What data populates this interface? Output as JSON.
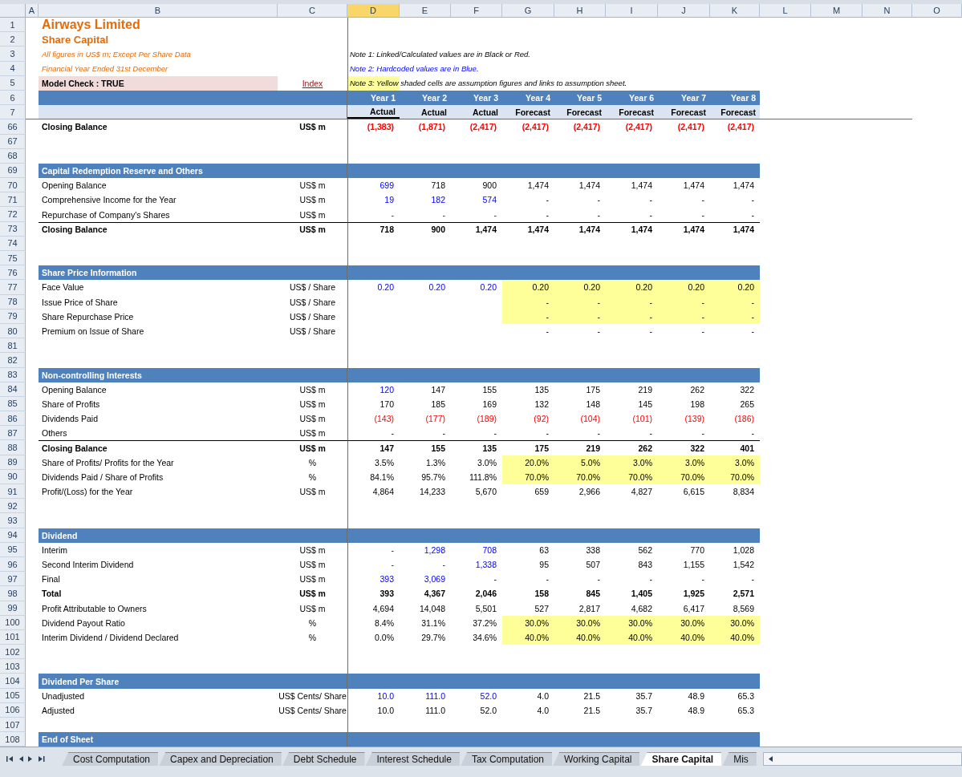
{
  "column_headers": [
    {
      "label": "A",
      "selected": false
    },
    {
      "label": "B",
      "selected": false
    },
    {
      "label": "C",
      "selected": false
    },
    {
      "label": "D",
      "selected": true
    },
    {
      "label": "E",
      "selected": false
    },
    {
      "label": "F",
      "selected": false
    },
    {
      "label": "G",
      "selected": false
    },
    {
      "label": "H",
      "selected": false
    },
    {
      "label": "I",
      "selected": false
    },
    {
      "label": "J",
      "selected": false
    },
    {
      "label": "K",
      "selected": false
    },
    {
      "label": "L",
      "selected": false
    },
    {
      "label": "M",
      "selected": false
    },
    {
      "label": "N",
      "selected": false
    },
    {
      "label": "O",
      "selected": false
    }
  ],
  "rows": [
    {
      "number": "1",
      "kind": "title",
      "text": "Airways Limited"
    },
    {
      "number": "2",
      "kind": "subtitle",
      "text": "Share Capital"
    },
    {
      "number": "3",
      "kind": "info",
      "text": "All figures in US$ m; Except Per Share Data",
      "note": {
        "text": "Note 1: Linked/Calculated values are in Black or Red.",
        "input": false,
        "highlighted": false
      }
    },
    {
      "number": "4",
      "kind": "info",
      "text": "Financial Year Ended 31st December",
      "note": {
        "text": "Note 2: Hardcoded values are in Blue.",
        "input": true,
        "highlighted": false
      }
    },
    {
      "number": "5",
      "kind": "check",
      "text": "Model Check : TRUE",
      "link": "Index",
      "note": {
        "text": "Note 3: Yellow shaded cells are assumption figures and links to assumption sheet.",
        "input": false,
        "highlighted": true
      }
    },
    {
      "number": "6",
      "kind": "years",
      "values": [
        "Year 1",
        "Year 2",
        "Year 3",
        "Year 4",
        "Year 5",
        "Year 6",
        "Year 7",
        "Year 8"
      ]
    },
    {
      "number": "7",
      "kind": "periods",
      "values": [
        {
          "text": "Actual",
          "selected": true
        },
        {
          "text": "Actual",
          "selected": false
        },
        {
          "text": "Actual",
          "selected": false
        },
        {
          "text": "Forecast",
          "selected": false
        },
        {
          "text": "Forecast",
          "selected": false
        },
        {
          "text": "Forecast",
          "selected": false
        },
        {
          "text": "Forecast",
          "selected": false
        },
        {
          "text": "Forecast",
          "selected": false
        }
      ]
    },
    {
      "number": "66",
      "kind": "data",
      "label": "Closing Balance",
      "unit": "US$ m",
      "bold": true,
      "rule": false,
      "shaded": false,
      "negative": true,
      "actuals": [
        {
          "text": "(1,383)",
          "input": false
        },
        {
          "text": "(1,871)",
          "input": false
        },
        {
          "text": "(2,417)",
          "input": false
        }
      ],
      "forecasts": [
        "(2,417)",
        "(2,417)",
        "(2,417)",
        "(2,417)",
        "(2,417)"
      ]
    },
    {
      "number": "67",
      "kind": "blank"
    },
    {
      "number": "68",
      "kind": "blank"
    },
    {
      "number": "69",
      "kind": "section",
      "text": "Capital Redemption Reserve and Others"
    },
    {
      "number": "70",
      "kind": "data",
      "label": "Opening Balance",
      "unit": "US$ m",
      "bold": false,
      "rule": false,
      "shaded": false,
      "negative": false,
      "actuals": [
        {
          "text": "699",
          "input": true
        },
        {
          "text": "718",
          "input": false
        },
        {
          "text": "900",
          "input": false
        }
      ],
      "forecasts": [
        "1,474",
        "1,474",
        "1,474",
        "1,474",
        "1,474"
      ]
    },
    {
      "number": "71",
      "kind": "data",
      "label": "Comprehensive Income for the Year",
      "unit": "US$ m",
      "bold": false,
      "rule": false,
      "shaded": false,
      "negative": false,
      "actuals": [
        {
          "text": "19",
          "input": true
        },
        {
          "text": "182",
          "input": true
        },
        {
          "text": "574",
          "input": true
        }
      ],
      "forecasts": [
        "-",
        "-",
        "-",
        "-",
        "-"
      ]
    },
    {
      "number": "72",
      "kind": "data",
      "label": "Repurchase of Company's Shares",
      "unit": "US$ m",
      "bold": false,
      "rule": false,
      "shaded": false,
      "negative": false,
      "actuals": [
        {
          "text": "-",
          "input": true
        },
        {
          "text": "-",
          "input": true
        },
        {
          "text": "-",
          "input": true
        }
      ],
      "forecasts": [
        "-",
        "-",
        "-",
        "-",
        "-"
      ]
    },
    {
      "number": "73",
      "kind": "data",
      "label": "Closing Balance",
      "unit": "US$ m",
      "bold": true,
      "rule": true,
      "shaded": false,
      "negative": false,
      "actuals": [
        {
          "text": "718",
          "input": false
        },
        {
          "text": "900",
          "input": false
        },
        {
          "text": "1,474",
          "input": false
        }
      ],
      "forecasts": [
        "1,474",
        "1,474",
        "1,474",
        "1,474",
        "1,474"
      ]
    },
    {
      "number": "74",
      "kind": "blank"
    },
    {
      "number": "75",
      "kind": "blank"
    },
    {
      "number": "76",
      "kind": "section",
      "text": "Share Price Information"
    },
    {
      "number": "77",
      "kind": "data",
      "label": "Face Value",
      "unit": "US$ / Share",
      "bold": false,
      "rule": false,
      "shaded": true,
      "negative": false,
      "actuals": [
        {
          "text": "0.20",
          "input": true
        },
        {
          "text": "0.20",
          "input": true
        },
        {
          "text": "0.20",
          "input": true
        }
      ],
      "forecasts": [
        "0.20",
        "0.20",
        "0.20",
        "0.20",
        "0.20"
      ]
    },
    {
      "number": "78",
      "kind": "data",
      "label": "Issue Price of Share",
      "unit": "US$ / Share",
      "bold": false,
      "rule": false,
      "shaded": true,
      "negative": false,
      "forecasts": [
        "-",
        "-",
        "-",
        "-",
        "-"
      ]
    },
    {
      "number": "79",
      "kind": "data",
      "label": "Share Repurchase Price",
      "unit": "US$ / Share",
      "bold": false,
      "rule": false,
      "shaded": true,
      "negative": false,
      "forecasts": [
        "-",
        "-",
        "-",
        "-",
        "-"
      ]
    },
    {
      "number": "80",
      "kind": "data",
      "label": "Premium on Issue of Share",
      "unit": "US$ / Share",
      "bold": false,
      "rule": false,
      "shaded": false,
      "negative": false,
      "forecasts": [
        "-",
        "-",
        "-",
        "-",
        "-"
      ]
    },
    {
      "number": "81",
      "kind": "blank"
    },
    {
      "number": "82",
      "kind": "blank"
    },
    {
      "number": "83",
      "kind": "section",
      "text": "Non-controlling Interests"
    },
    {
      "number": "84",
      "kind": "data",
      "label": "Opening Balance",
      "unit": "US$ m",
      "bold": false,
      "rule": false,
      "shaded": false,
      "negative": false,
      "actuals": [
        {
          "text": "120",
          "input": true
        },
        {
          "text": "147",
          "input": false
        },
        {
          "text": "155",
          "input": false
        }
      ],
      "forecasts": [
        "135",
        "175",
        "219",
        "262",
        "322"
      ]
    },
    {
      "number": "85",
      "kind": "data",
      "label": "Share of Profits",
      "unit": "US$ m",
      "bold": false,
      "rule": false,
      "shaded": false,
      "negative": false,
      "actuals": [
        {
          "text": "170",
          "input": false
        },
        {
          "text": "185",
          "input": false
        },
        {
          "text": "169",
          "input": false
        }
      ],
      "forecasts": [
        "132",
        "148",
        "145",
        "198",
        "265"
      ]
    },
    {
      "number": "86",
      "kind": "data",
      "label": "Dividends Paid",
      "unit": "US$ m",
      "bold": false,
      "rule": false,
      "shaded": false,
      "negative": true,
      "actuals": [
        {
          "text": "(143)",
          "input": false
        },
        {
          "text": "(177)",
          "input": false
        },
        {
          "text": "(189)",
          "input": false
        }
      ],
      "forecasts": [
        "(92)",
        "(104)",
        "(101)",
        "(139)",
        "(186)"
      ]
    },
    {
      "number": "87",
      "kind": "data",
      "label": "Others",
      "unit": "US$ m",
      "bold": false,
      "rule": false,
      "shaded": false,
      "negative": false,
      "actuals": [
        {
          "text": "-",
          "input": false
        },
        {
          "text": "-",
          "input": false
        },
        {
          "text": "-",
          "input": false
        }
      ],
      "forecasts": [
        "-",
        "-",
        "-",
        "-",
        "-"
      ]
    },
    {
      "number": "88",
      "kind": "data",
      "label": "Closing Balance",
      "unit": "US$ m",
      "bold": true,
      "rule": true,
      "shaded": false,
      "negative": false,
      "actuals": [
        {
          "text": "147",
          "input": false
        },
        {
          "text": "155",
          "input": false
        },
        {
          "text": "135",
          "input": false
        }
      ],
      "forecasts": [
        "175",
        "219",
        "262",
        "322",
        "401"
      ]
    },
    {
      "number": "89",
      "kind": "data",
      "label": "Share of Profits/ Profits for the Year",
      "unit": "%",
      "bold": false,
      "rule": false,
      "shaded": true,
      "negative": false,
      "actuals": [
        {
          "text": "3.5%",
          "input": false
        },
        {
          "text": "1.3%",
          "input": false
        },
        {
          "text": "3.0%",
          "input": false
        }
      ],
      "forecasts": [
        "20.0%",
        "5.0%",
        "3.0%",
        "3.0%",
        "3.0%"
      ]
    },
    {
      "number": "90",
      "kind": "data",
      "label": "Dividends Paid / Share of Profits",
      "unit": "%",
      "bold": false,
      "rule": false,
      "shaded": true,
      "negative": false,
      "actuals": [
        {
          "text": "84.1%",
          "input": false
        },
        {
          "text": "95.7%",
          "input": false
        },
        {
          "text": "111.8%",
          "input": false
        }
      ],
      "forecasts": [
        "70.0%",
        "70.0%",
        "70.0%",
        "70.0%",
        "70.0%"
      ]
    },
    {
      "number": "91",
      "kind": "data",
      "label": "Profit/(Loss) for the Year",
      "unit": "US$ m",
      "bold": false,
      "rule": false,
      "shaded": false,
      "negative": false,
      "actuals": [
        {
          "text": "4,864",
          "input": false
        },
        {
          "text": "14,233",
          "input": false
        },
        {
          "text": "5,670",
          "input": false
        }
      ],
      "forecasts": [
        "659",
        "2,966",
        "4,827",
        "6,615",
        "8,834"
      ]
    },
    {
      "number": "92",
      "kind": "blank"
    },
    {
      "number": "93",
      "kind": "blank"
    },
    {
      "number": "94",
      "kind": "section",
      "text": "Dividend"
    },
    {
      "number": "95",
      "kind": "data",
      "label": "Interim",
      "unit": "US$ m",
      "bold": false,
      "rule": false,
      "shaded": false,
      "negative": false,
      "actuals": [
        {
          "text": "-",
          "input": true
        },
        {
          "text": "1,298",
          "input": true
        },
        {
          "text": "708",
          "input": true
        }
      ],
      "forecasts": [
        "63",
        "338",
        "562",
        "770",
        "1,028"
      ]
    },
    {
      "number": "96",
      "kind": "data",
      "label": "Second Interim Dividend",
      "unit": "US$ m",
      "bold": false,
      "rule": false,
      "shaded": false,
      "negative": false,
      "actuals": [
        {
          "text": "-",
          "input": true
        },
        {
          "text": "-",
          "input": true
        },
        {
          "text": "1,338",
          "input": true
        }
      ],
      "forecasts": [
        "95",
        "507",
        "843",
        "1,155",
        "1,542"
      ]
    },
    {
      "number": "97",
      "kind": "data",
      "label": "Final",
      "unit": "US$ m",
      "bold": false,
      "rule": false,
      "shaded": false,
      "negative": false,
      "actuals": [
        {
          "text": "393",
          "input": true
        },
        {
          "text": "3,069",
          "input": true
        },
        {
          "text": "-",
          "input": false
        }
      ],
      "forecasts": [
        "-",
        "-",
        "-",
        "-",
        "-"
      ]
    },
    {
      "number": "98",
      "kind": "data",
      "label": "Total",
      "unit": "US$ m",
      "bold": true,
      "rule": false,
      "shaded": false,
      "negative": false,
      "actuals": [
        {
          "text": "393",
          "input": false
        },
        {
          "text": "4,367",
          "input": false
        },
        {
          "text": "2,046",
          "input": false
        }
      ],
      "forecasts": [
        "158",
        "845",
        "1,405",
        "1,925",
        "2,571"
      ]
    },
    {
      "number": "99",
      "kind": "data",
      "label": "Profit Attributable to Owners",
      "unit": "US$ m",
      "bold": false,
      "rule": false,
      "shaded": false,
      "negative": false,
      "actuals": [
        {
          "text": "4,694",
          "input": false
        },
        {
          "text": "14,048",
          "input": false
        },
        {
          "text": "5,501",
          "input": false
        }
      ],
      "forecasts": [
        "527",
        "2,817",
        "4,682",
        "6,417",
        "8,569"
      ]
    },
    {
      "number": "100",
      "kind": "data",
      "label": "Dividend Payout Ratio",
      "unit": "%",
      "bold": false,
      "rule": false,
      "shaded": true,
      "negative": false,
      "actuals": [
        {
          "text": "8.4%",
          "input": false
        },
        {
          "text": "31.1%",
          "input": false
        },
        {
          "text": "37.2%",
          "input": false
        }
      ],
      "forecasts": [
        "30.0%",
        "30.0%",
        "30.0%",
        "30.0%",
        "30.0%"
      ]
    },
    {
      "number": "101",
      "kind": "data",
      "label": "Interim Dividend / Dividend Declared",
      "unit": "%",
      "bold": false,
      "rule": false,
      "shaded": true,
      "negative": false,
      "actuals": [
        {
          "text": "0.0%",
          "input": false
        },
        {
          "text": "29.7%",
          "input": false
        },
        {
          "text": "34.6%",
          "input": false
        }
      ],
      "forecasts": [
        "40.0%",
        "40.0%",
        "40.0%",
        "40.0%",
        "40.0%"
      ]
    },
    {
      "number": "102",
      "kind": "blank"
    },
    {
      "number": "103",
      "kind": "blank"
    },
    {
      "number": "104",
      "kind": "section",
      "text": "Dividend Per Share"
    },
    {
      "number": "105",
      "kind": "data",
      "label": "Unadjusted",
      "unit": "US$ Cents/ Share",
      "bold": false,
      "rule": false,
      "shaded": false,
      "negative": false,
      "actuals": [
        {
          "text": "10.0",
          "input": true
        },
        {
          "text": "111.0",
          "input": true
        },
        {
          "text": "52.0",
          "input": true
        }
      ],
      "forecasts": [
        "4.0",
        "21.5",
        "35.7",
        "48.9",
        "65.3"
      ]
    },
    {
      "number": "106",
      "kind": "data",
      "label": "Adjusted",
      "unit": "US$ Cents/ Share",
      "bold": false,
      "rule": false,
      "shaded": false,
      "negative": false,
      "actuals": [
        {
          "text": "10.0",
          "input": false
        },
        {
          "text": "111.0",
          "input": false
        },
        {
          "text": "52.0",
          "input": false
        }
      ],
      "forecasts": [
        "4.0",
        "21.5",
        "35.7",
        "48.9",
        "65.3"
      ]
    },
    {
      "number": "107",
      "kind": "blank"
    },
    {
      "number": "108",
      "kind": "section",
      "text": "End of Sheet"
    }
  ],
  "sheet_tabs": [
    {
      "label": "Cost Computation",
      "selected": false
    },
    {
      "label": "Capex and Depreciation",
      "selected": false
    },
    {
      "label": "Debt Schedule",
      "selected": false
    },
    {
      "label": "Interest Schedule",
      "selected": false
    },
    {
      "label": "Tax Computation",
      "selected": false
    },
    {
      "label": "Working Capital",
      "selected": false
    },
    {
      "label": "Share Capital",
      "selected": true
    },
    {
      "label": "Mis",
      "selected": false
    }
  ]
}
